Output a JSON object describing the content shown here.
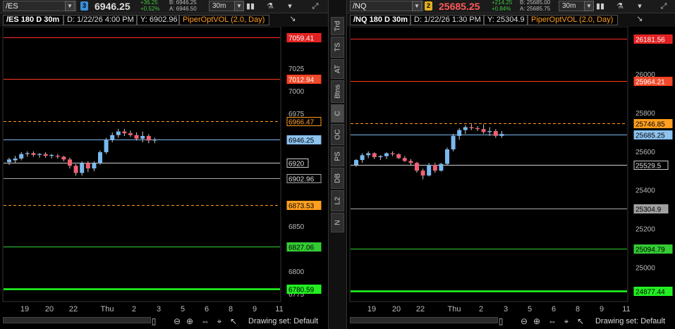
{
  "left": {
    "symbol": "/ES",
    "link_num": "3",
    "link_color": "#3a8fd8",
    "last_price": "6946.25",
    "price_color": "#dddddd",
    "change": "+36.25",
    "change_pct": "+0.52%",
    "bid": "B: 6946.25",
    "ask": "A: 6946.50",
    "period": "30m",
    "chart_title": "/ES 180 D 30m",
    "date_readout": "D: 1/22/26 4:00 PM",
    "y_readout": "Y: 6902.96",
    "study": "PiperOptVOL (2.0, Day)",
    "y_ticks": [
      "7025",
      "7000",
      "6975",
      "6850",
      "6825",
      "6800",
      "6775"
    ],
    "x_ticks": [
      "19",
      "20",
      "22",
      "Thu",
      "2",
      "3",
      "5",
      "6",
      "8",
      "9",
      "11"
    ],
    "level_tags": [
      {
        "value": "7059.41",
        "color": "#ff2a2a",
        "bg": "#e02020",
        "fg": "#ffffff"
      },
      {
        "value": "7012.94",
        "color": "#ff3a1a",
        "bg": "#ef4a2a",
        "fg": "#ffffff"
      },
      {
        "value": "6966.47",
        "color": "#ff9a1a",
        "bg": "#000000",
        "fg": "#ffa030"
      },
      {
        "value": "6946.25",
        "color": "#7ab8f0",
        "bg": "#8fc4f0",
        "fg": "#000000"
      },
      {
        "value": "6920",
        "color": "#cccccc",
        "bg": "#000000",
        "fg": "#dddddd"
      },
      {
        "value": "6902.96",
        "color": "#aaaaaa",
        "bg": "#000000",
        "fg": "#dddddd"
      },
      {
        "value": "6873.53",
        "color": "#ff9a1a",
        "bg": "#ffa020",
        "fg": "#000000"
      },
      {
        "value": "6827.06",
        "color": "#33cc33",
        "bg": "#33cc33",
        "fg": "#000000"
      },
      {
        "value": "6780.59",
        "color": "#22ff22",
        "bg": "#22ee22",
        "fg": "#000000"
      }
    ],
    "drawing_set": "Drawing set: Default"
  },
  "right": {
    "symbol": "/NQ",
    "link_num": "2",
    "link_color": "#e0b020",
    "last_price": "25685.25",
    "price_color": "#ff5a5a",
    "change": "+214.25",
    "change_pct": "+0.84%",
    "bid": "B: 25685.00",
    "ask": "A: 25685.75",
    "period": "30m",
    "chart_title": "/NQ 180 D 30m",
    "date_readout": "D: 1/22/26 1:30 PM",
    "y_readout": "Y: 25304.9",
    "study": "PiperOptVOL (2.0, Day)",
    "y_ticks": [
      "26000",
      "25800",
      "25600",
      "25400",
      "25200",
      "25000"
    ],
    "x_ticks": [
      "19",
      "20",
      "22",
      "Thu",
      "2",
      "3",
      "5",
      "6",
      "8",
      "9",
      "11"
    ],
    "level_tags": [
      {
        "value": "26181.56",
        "color": "#ff2a2a",
        "bg": "#e02020",
        "fg": "#ffffff"
      },
      {
        "value": "25964.21",
        "color": "#ff3a1a",
        "bg": "#ef4a2a",
        "fg": "#ffffff"
      },
      {
        "value": "25746.85",
        "color": "#ff9a1a",
        "bg": "#ffa020",
        "fg": "#000000"
      },
      {
        "value": "25685.25",
        "color": "#7ab8f0",
        "bg": "#8fc4f0",
        "fg": "#000000"
      },
      {
        "value": "25529.5",
        "color": "#cccccc",
        "bg": "#000000",
        "fg": "#dddddd"
      },
      {
        "value": "25304.9",
        "color": "#aaaaaa",
        "bg": "#a0a0a0",
        "fg": "#000000"
      },
      {
        "value": "25094.79",
        "color": "#33cc33",
        "bg": "#33cc33",
        "fg": "#000000"
      },
      {
        "value": "24877.44",
        "color": "#22ff22",
        "bg": "#22ee22",
        "fg": "#000000"
      }
    ],
    "drawing_set": "Drawing set: Default"
  },
  "sidebar": [
    "Trd",
    "TS",
    "AT",
    "Btns",
    "C",
    "OC",
    "PS",
    "DB",
    "L2",
    "N"
  ],
  "chart_data": [
    {
      "type": "candlestick",
      "title": "/ES 180 D 30m",
      "ylim": [
        6768,
        7068
      ],
      "candles": [
        [
          6921,
          6926,
          6918,
          6924
        ],
        [
          6923,
          6928,
          6920,
          6925
        ],
        [
          6925,
          6932,
          6923,
          6930
        ],
        [
          6930,
          6933,
          6927,
          6931
        ],
        [
          6931,
          6933,
          6927,
          6929
        ],
        [
          6929,
          6931,
          6926,
          6930
        ],
        [
          6930,
          6932,
          6926,
          6928
        ],
        [
          6928,
          6930,
          6925,
          6929
        ],
        [
          6928,
          6930,
          6925,
          6927
        ],
        [
          6927,
          6928,
          6922,
          6924
        ],
        [
          6924,
          6926,
          6914,
          6917
        ],
        [
          6917,
          6919,
          6906,
          6909
        ],
        [
          6909,
          6922,
          6906,
          6920
        ],
        [
          6920,
          6922,
          6910,
          6914
        ],
        [
          6914,
          6922,
          6911,
          6920
        ],
        [
          6920,
          6934,
          6918,
          6932
        ],
        [
          6932,
          6948,
          6930,
          6946
        ],
        [
          6946,
          6954,
          6943,
          6951
        ],
        [
          6951,
          6958,
          6948,
          6955
        ],
        [
          6955,
          6958,
          6950,
          6953
        ],
        [
          6953,
          6956,
          6949,
          6951
        ],
        [
          6951,
          6954,
          6945,
          6947
        ],
        [
          6947,
          6955,
          6943,
          6950
        ],
        [
          6950,
          6952,
          6942,
          6945
        ],
        [
          6945,
          6948,
          6942,
          6946
        ]
      ]
    },
    {
      "type": "candlestick",
      "title": "/NQ 180 D 30m",
      "ylim": [
        24830,
        26230
      ],
      "candles": [
        [
          25530,
          25560,
          25520,
          25555
        ],
        [
          25555,
          25590,
          25540,
          25580
        ],
        [
          25580,
          25600,
          25565,
          25590
        ],
        [
          25590,
          25595,
          25560,
          25570
        ],
        [
          25570,
          25580,
          25555,
          25575
        ],
        [
          25575,
          25595,
          25560,
          25590
        ],
        [
          25590,
          25600,
          25575,
          25585
        ],
        [
          25585,
          25590,
          25560,
          25565
        ],
        [
          25565,
          25575,
          25545,
          25550
        ],
        [
          25550,
          25560,
          25530,
          25540
        ],
        [
          25540,
          25545,
          25490,
          25500
        ],
        [
          25500,
          25510,
          25455,
          25475
        ],
        [
          25475,
          25540,
          25470,
          25530
        ],
        [
          25530,
          25540,
          25490,
          25500
        ],
        [
          25500,
          25540,
          25495,
          25535
        ],
        [
          25535,
          25620,
          25530,
          25610
        ],
        [
          25610,
          25690,
          25600,
          25680
        ],
        [
          25680,
          25720,
          25660,
          25710
        ],
        [
          25710,
          25735,
          25690,
          25725
        ],
        [
          25725,
          25740,
          25710,
          25720
        ],
        [
          25720,
          25730,
          25705,
          25715
        ],
        [
          25715,
          25740,
          25690,
          25700
        ],
        [
          25700,
          25725,
          25680,
          25705
        ],
        [
          25705,
          25715,
          25670,
          25680
        ],
        [
          25680,
          25705,
          25670,
          25690
        ]
      ]
    }
  ]
}
